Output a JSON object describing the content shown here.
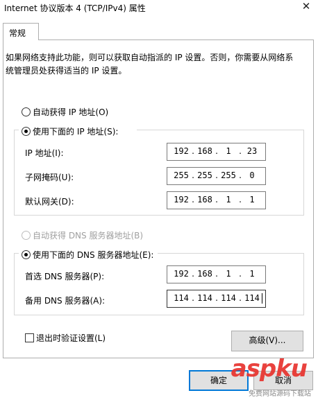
{
  "window": {
    "title": "Internet 协议版本 4 (TCP/IPv4) 属性",
    "close_glyph": "✕"
  },
  "tabs": [
    {
      "label": "常规"
    }
  ],
  "description": "如果网络支持此功能，则可以获取自动指派的 IP 设置。否则，你需要从网络系统管理员处获得适当的 IP 设置。",
  "ip_mode": {
    "auto_label": "自动获得 IP 地址(O)",
    "manual_label": "使用下面的 IP 地址(S):",
    "selected": "manual"
  },
  "ip_fields": [
    {
      "label": "IP 地址(I):",
      "octets": [
        "192",
        "168",
        "1",
        "23"
      ]
    },
    {
      "label": "子网掩码(U):",
      "octets": [
        "255",
        "255",
        "255",
        "0"
      ]
    },
    {
      "label": "默认网关(D):",
      "octets": [
        "192",
        "168",
        "1",
        "1"
      ]
    }
  ],
  "dns_mode": {
    "auto_label": "自动获得 DNS 服务器地址(B)",
    "manual_label": "使用下面的 DNS 服务器地址(E):",
    "selected": "manual"
  },
  "dns_fields": [
    {
      "label": "首选 DNS 服务器(P):",
      "octets": [
        "192",
        "168",
        "1",
        "1"
      ]
    },
    {
      "label": "备用 DNS 服务器(A):",
      "octets": [
        "114",
        "114",
        "114",
        "114"
      ]
    }
  ],
  "validate_on_exit": {
    "label": "退出时验证设置(L)",
    "checked": false
  },
  "buttons": {
    "advanced": "高级(V)...",
    "ok": "确定",
    "cancel": "取消"
  },
  "watermark": {
    "brand": "aspku",
    "tagline": "免费网站源码下载站"
  },
  "colors": {
    "accent": "#0078d7",
    "watermark": "#e8332e"
  }
}
